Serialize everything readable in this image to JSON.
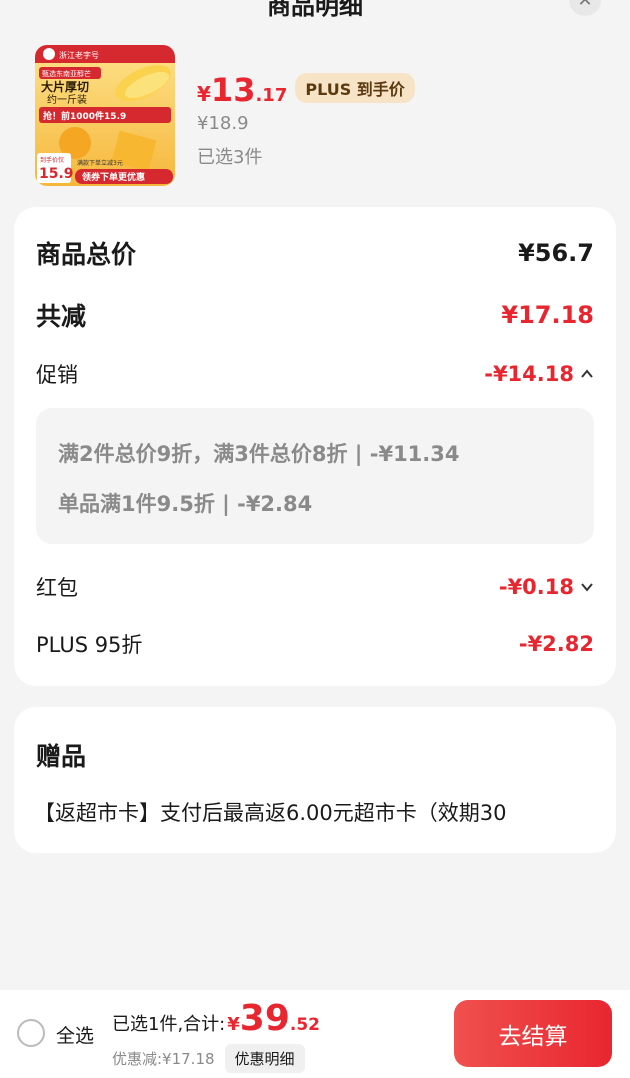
{
  "header": {
    "title": "商品明细"
  },
  "product": {
    "image_texts": {
      "brand": "浙江老字号",
      "badge": "甄选东南亚醇芒",
      "headline1": "大片厚切",
      "headline2": "约一斤装",
      "promo": "抢！前1000件15.9",
      "price_label": "到手价仅",
      "price": "15.9",
      "coupon": "领券下单更优惠",
      "sub": "满款下单立减3元"
    },
    "price_currency": "¥",
    "price_integer": "13",
    "price_decimal": ".17",
    "plus_tag": "PLUS 到手价",
    "original_price": "¥18.9",
    "selected_count": "已选3件"
  },
  "summary": {
    "total_label": "商品总价",
    "total_value": "¥56.7",
    "reduce_label": "共减",
    "reduce_value": "¥17.18",
    "promo_label": "促销",
    "promo_value": "-¥14.18",
    "promo_details": [
      "满2件总价9折，满3件总价8折 | -¥11.34",
      "单品满1件9.5折 | -¥2.84"
    ],
    "redpacket_label": "红包",
    "redpacket_value": "-¥0.18",
    "plus_label": "PLUS 95折",
    "plus_value": "-¥2.82"
  },
  "gift": {
    "title": "赠品",
    "text": "【返超市卡】支付后最高返6.00元超市卡（效期30"
  },
  "bottom": {
    "select_all": "全选",
    "sum_label": "已选1件,合计:",
    "sum_currency": "¥",
    "sum_integer": "39",
    "sum_decimal": ".52",
    "discount_text": "优惠减:¥17.18",
    "detail_button": "优惠明细",
    "checkout_button": "去结算"
  },
  "colors": {
    "accent_red": "#e8262f",
    "plus_gold": "#f7e4c6"
  }
}
